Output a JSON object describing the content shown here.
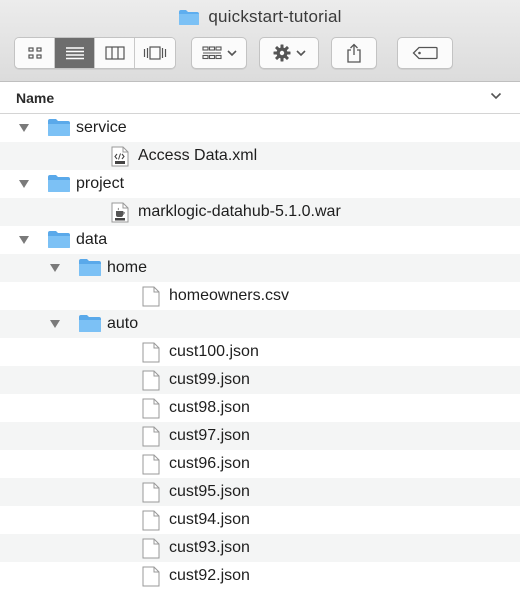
{
  "window": {
    "title": "quickstart-tutorial",
    "folder_color": "#6cb6f2"
  },
  "toolbar": {
    "view_buttons": [
      {
        "icon": "icon-view-icon",
        "active": false
      },
      {
        "icon": "list-view-icon",
        "active": true
      },
      {
        "icon": "column-view-icon",
        "active": false
      },
      {
        "icon": "cover-flow-view-icon",
        "active": false
      }
    ],
    "group_icon": "group-by-icon",
    "action_icon": "gear-icon",
    "share_icon": "share-icon",
    "tag_icon": "tag-icon"
  },
  "columns": {
    "name_label": "Name"
  },
  "items": [
    {
      "label": "service",
      "type": "folder",
      "level": 0,
      "expanded": true
    },
    {
      "label": "Access Data.xml",
      "type": "xml",
      "level": 1
    },
    {
      "label": "project",
      "type": "folder",
      "level": 0,
      "expanded": true
    },
    {
      "label": "marklogic-datahub-5.1.0.war",
      "type": "jar",
      "level": 1
    },
    {
      "label": "data",
      "type": "folder",
      "level": 0,
      "expanded": true
    },
    {
      "label": "home",
      "type": "folder",
      "level": 1,
      "expanded": true
    },
    {
      "label": "homeowners.csv",
      "type": "file",
      "level": 2
    },
    {
      "label": "auto",
      "type": "folder",
      "level": 1,
      "expanded": true
    },
    {
      "label": "cust100.json",
      "type": "file",
      "level": 2
    },
    {
      "label": "cust99.json",
      "type": "file",
      "level": 2
    },
    {
      "label": "cust98.json",
      "type": "file",
      "level": 2
    },
    {
      "label": "cust97.json",
      "type": "file",
      "level": 2
    },
    {
      "label": "cust96.json",
      "type": "file",
      "level": 2
    },
    {
      "label": "cust95.json",
      "type": "file",
      "level": 2
    },
    {
      "label": "cust94.json",
      "type": "file",
      "level": 2
    },
    {
      "label": "cust93.json",
      "type": "file",
      "level": 2
    },
    {
      "label": "cust92.json",
      "type": "file",
      "level": 2
    }
  ]
}
